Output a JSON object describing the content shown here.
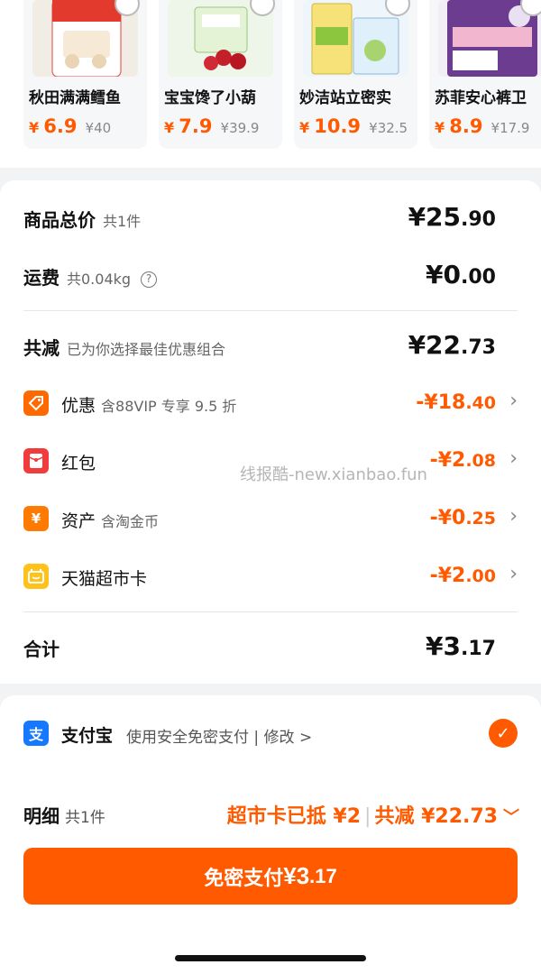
{
  "products": [
    {
      "name": "秋田满满鳕鱼",
      "price_symbol": "¥",
      "price": "6.9",
      "orig_price": "¥40"
    },
    {
      "name": "宝宝馋了小葫",
      "price_symbol": "¥",
      "price": "7.9",
      "orig_price": "¥39.9"
    },
    {
      "name": "妙洁站立密实",
      "price_symbol": "¥",
      "price": "10.9",
      "orig_price": "¥32.5"
    },
    {
      "name": "苏菲安心裤卫",
      "price_symbol": "¥",
      "price": "8.9",
      "orig_price": "¥17.9"
    }
  ],
  "summary": {
    "total": {
      "label": "商品总价",
      "sub": "共1件",
      "int": "¥25",
      "dec": ".90"
    },
    "shipping": {
      "label": "运费",
      "sub": "共0.04kg",
      "help_icon": "question-circle-icon",
      "int": "¥0",
      "dec": ".00"
    },
    "reduce": {
      "label": "共减",
      "sub": "已为你选择最佳优惠组合",
      "int": "¥22",
      "dec": ".73"
    },
    "discounts": [
      {
        "label": "优惠",
        "sub": "含88VIP 专享 9.5 折",
        "int": "-¥18",
        "dec": ".40",
        "icon": "coupon-tag-icon",
        "color": "#ff6a00"
      },
      {
        "label": "红包",
        "sub": "",
        "int": "-¥2",
        "dec": ".08",
        "icon": "red-packet-icon",
        "color": "#f23c3c"
      },
      {
        "label": "资产",
        "sub": "含淘金币",
        "int": "-¥0",
        "dec": ".25",
        "icon": "yen-asset-icon",
        "color": "#ff7a00"
      },
      {
        "label": "天猫超市卡",
        "sub": "",
        "int": "-¥2",
        "dec": ".00",
        "icon": "supermarket-card-icon",
        "color": "#ffc21a"
      }
    ],
    "grand": {
      "label": "合计",
      "int": "¥3",
      "dec": ".17"
    }
  },
  "watermark": "线报酷-new.xianbao.fun",
  "payment": {
    "method": "支付宝",
    "desc": "使用安全免密支付 | 修改 >",
    "icon_text": "支",
    "check_glyph": "✓"
  },
  "detail": {
    "label": "明细",
    "sub": "共1件",
    "card": "超市卡已抵 ¥2",
    "sep": "|",
    "reduce": "共减 ¥22.73",
    "chev": "﹀"
  },
  "pay_button": {
    "label": "免密支付 ",
    "int": "¥3",
    "dec": ".17"
  },
  "colors": {
    "accent": "#ff5a00",
    "alipay": "#1677ff"
  }
}
